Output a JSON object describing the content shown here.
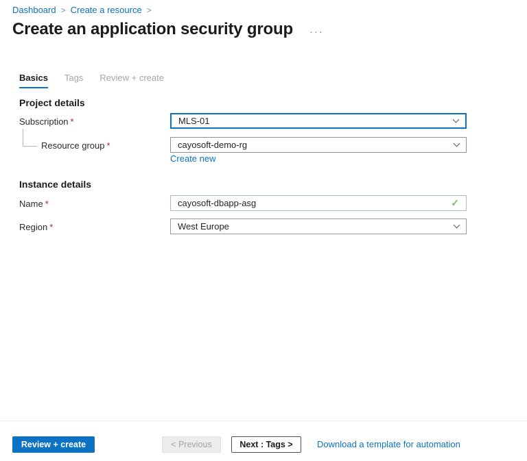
{
  "breadcrumb": {
    "separator": ">",
    "items": [
      {
        "label": "Dashboard"
      },
      {
        "label": "Create a resource"
      }
    ]
  },
  "page": {
    "title": "Create an application security group",
    "more_options": "···"
  },
  "tabs": [
    {
      "label": "Basics",
      "active": true
    },
    {
      "label": "Tags",
      "active": false
    },
    {
      "label": "Review + create",
      "active": false
    }
  ],
  "form": {
    "project_details": {
      "heading": "Project details",
      "subscription": {
        "label": "Subscription",
        "required_marker": "*",
        "value": "MLS-01"
      },
      "resource_group": {
        "label": "Resource group",
        "required_marker": "*",
        "value": "cayosoft-demo-rg",
        "create_new": "Create new"
      }
    },
    "instance_details": {
      "heading": "Instance details",
      "name": {
        "label": "Name",
        "required_marker": "*",
        "value": "cayosoft-dbapp-asg",
        "validation": "valid",
        "valid_icon": "checkmark"
      },
      "region": {
        "label": "Region",
        "required_marker": "*",
        "value": "West Europe"
      }
    }
  },
  "footer": {
    "review_create": "Review + create",
    "previous": "< Previous",
    "previous_disabled": true,
    "next": "Next : Tags >",
    "download_template": "Download a template for automation"
  },
  "colors": {
    "accent": "#0b72c4",
    "required_marker": "#a4262c",
    "valid_green": "#6fbf6f",
    "inactive_tab": "#a6a6a6"
  }
}
